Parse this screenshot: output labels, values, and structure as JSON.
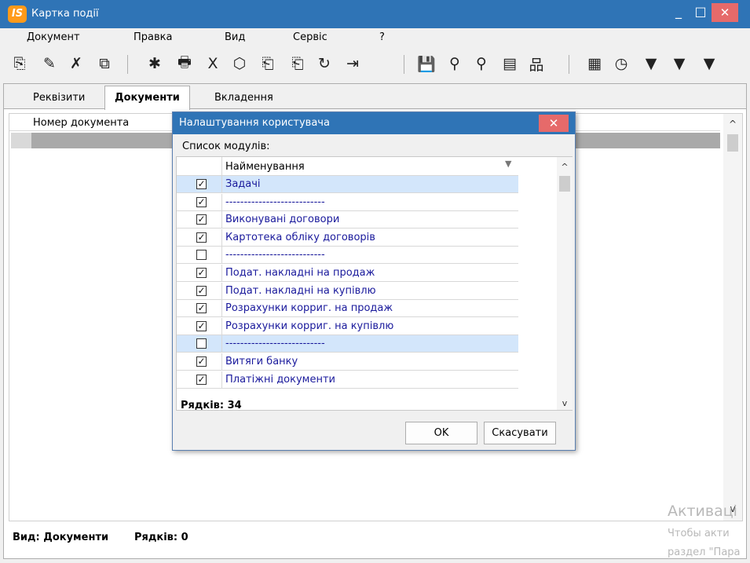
{
  "window": {
    "title": "Картка події",
    "logo_text": "IS",
    "minimize": "_",
    "maximize": "□",
    "close": "✕"
  },
  "menu": [
    "Документ",
    "Правка",
    "Вид",
    "Сервіс",
    "?"
  ],
  "toolbar_icons": [
    {
      "name": "new-doc-icon",
      "glyph": "⎘"
    },
    {
      "name": "edit-doc-icon",
      "glyph": "✎"
    },
    {
      "name": "delete-doc-icon",
      "glyph": "✗"
    },
    {
      "name": "copy-doc-icon",
      "glyph": "⧉"
    },
    {
      "name": "new-from-template-icon",
      "glyph": "✱"
    },
    {
      "name": "print-icon",
      "glyph": "🖶"
    },
    {
      "name": "excel-export-icon",
      "glyph": "X"
    },
    {
      "name": "hexagon-icon",
      "glyph": "⬡"
    },
    {
      "name": "document-up-icon",
      "glyph": "⎗"
    },
    {
      "name": "document-down-icon",
      "glyph": "⎗"
    },
    {
      "name": "refresh-icon",
      "glyph": "↻"
    },
    {
      "name": "exit-icon",
      "glyph": "⇥"
    },
    {
      "name": "save-icon",
      "glyph": "💾"
    },
    {
      "name": "search-icon",
      "glyph": "⚲"
    },
    {
      "name": "search-next-icon",
      "glyph": "⚲"
    },
    {
      "name": "stack-icon",
      "glyph": "▤"
    },
    {
      "name": "hierarchy-icon",
      "glyph": "品"
    },
    {
      "name": "table-icon",
      "glyph": "▦"
    },
    {
      "name": "clock-doc-icon",
      "glyph": "◷"
    },
    {
      "name": "filter-icon",
      "glyph": "▼"
    },
    {
      "name": "filter-user-icon",
      "glyph": "▼"
    },
    {
      "name": "filter-clear-icon",
      "glyph": "▼"
    }
  ],
  "tabs": [
    "Реквізити",
    "Документи",
    "Вкладення"
  ],
  "active_tab": "Документи",
  "grid": {
    "column_header": "Номер документа",
    "scroll_up": "^",
    "scroll_down": "v"
  },
  "footer": {
    "view": "Вид: Документи",
    "rows": "Рядків: 0"
  },
  "watermark": {
    "line1": "Активаці",
    "line2": "Чтобы акти",
    "line3": "раздел \"Пара"
  },
  "dialog": {
    "title": "Налаштування користувача",
    "close": "✕",
    "list_label": "Список модулів:",
    "column_header": "Найменування",
    "rows": [
      {
        "checked": true,
        "name": "Задачі",
        "highlighted": true
      },
      {
        "checked": true,
        "name": "---------------------------",
        "highlighted": false
      },
      {
        "checked": true,
        "name": "Виконувані договори",
        "highlighted": false
      },
      {
        "checked": true,
        "name": "Картотека обліку договорів",
        "highlighted": false
      },
      {
        "checked": false,
        "name": "---------------------------",
        "highlighted": false
      },
      {
        "checked": true,
        "name": "Подат. накладні на продаж",
        "highlighted": false
      },
      {
        "checked": true,
        "name": "Подат. накладні на купівлю",
        "highlighted": false
      },
      {
        "checked": true,
        "name": "Розрахунки корриг. на продаж",
        "highlighted": false
      },
      {
        "checked": true,
        "name": "Розрахунки корриг. на купівлю",
        "highlighted": false
      },
      {
        "checked": false,
        "name": "---------------------------",
        "highlighted": true
      },
      {
        "checked": true,
        "name": "Витяги банку",
        "highlighted": false
      },
      {
        "checked": true,
        "name": "Платіжні документи",
        "highlighted": false
      }
    ],
    "rows_count": "Рядків: 34",
    "ok_label": "OK",
    "cancel_label": "Скасувати",
    "dropdown_arrow": "▼"
  },
  "colors": {
    "titlebar": "#2f74b6",
    "close_button": "#e66a6a",
    "list_text": "#1a1a9c",
    "row_highlight": "#d3e6fb"
  }
}
